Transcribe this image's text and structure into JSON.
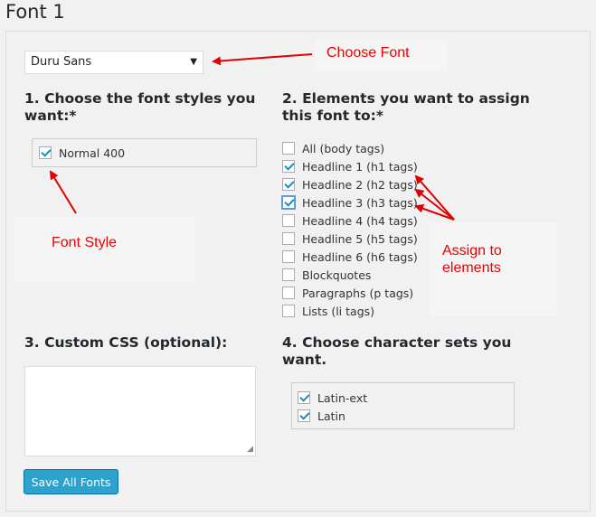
{
  "page_title": "Font 1",
  "font_select": {
    "value": "Duru Sans"
  },
  "section1": {
    "heading_line1": "1. Choose the font styles you",
    "heading_line2": "want:*",
    "styles": [
      {
        "label": "Normal 400",
        "checked": true
      }
    ]
  },
  "section2": {
    "heading_line1": "2. Elements you want to assign",
    "heading_line2": "this font to:*",
    "elements": [
      {
        "label": "All (body tags)",
        "checked": false
      },
      {
        "label": "Headline 1 (h1 tags)",
        "checked": true
      },
      {
        "label": "Headline 2 (h2 tags)",
        "checked": true
      },
      {
        "label": "Headline 3 (h3 tags)",
        "checked": true
      },
      {
        "label": "Headline 4 (h4 tags)",
        "checked": false
      },
      {
        "label": "Headline 5 (h5 tags)",
        "checked": false
      },
      {
        "label": "Headline 6 (h6 tags)",
        "checked": false
      },
      {
        "label": "Blockquotes",
        "checked": false
      },
      {
        "label": "Paragraphs (p tags)",
        "checked": false
      },
      {
        "label": "Lists (li tags)",
        "checked": false
      }
    ]
  },
  "section3": {
    "heading": "3. Custom CSS (optional):",
    "value": ""
  },
  "section4": {
    "heading_line1": "4. Choose character sets you",
    "heading_line2": "want.",
    "charsets": [
      {
        "label": "Latin-ext",
        "checked": true
      },
      {
        "label": "Latin",
        "checked": true
      }
    ]
  },
  "save_button": {
    "label": "Save All Fonts"
  },
  "annotations": {
    "choose_font": "Choose Font",
    "font_style": "Font Style",
    "assign_line1": "Assign to",
    "assign_line2": "elements",
    "color": "#e00000"
  }
}
